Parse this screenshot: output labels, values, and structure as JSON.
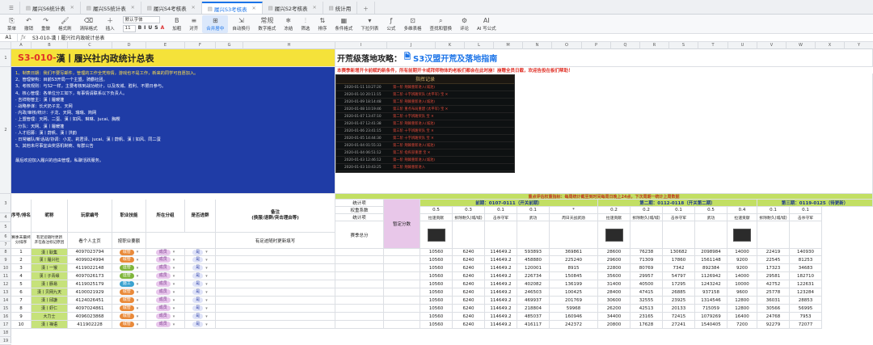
{
  "tabs": [
    {
      "label": "履兴S6统计表",
      "active": false
    },
    {
      "label": "履兴S5统计表",
      "active": false
    },
    {
      "label": "履兴S4考核表",
      "active": false
    },
    {
      "label": "履兴S3考核表",
      "active": true
    },
    {
      "label": "履兴S2考核表",
      "active": false
    },
    {
      "label": "统计用",
      "active": false
    }
  ],
  "toolbar": [
    {
      "icon": "⎘",
      "label": "菜单"
    },
    {
      "icon": "↶",
      "label": "撤销"
    },
    {
      "icon": "↷",
      "label": "重做"
    },
    {
      "icon": "🖌",
      "label": "格式刷"
    },
    {
      "icon": "⌫",
      "label": "清除格式"
    },
    {
      "icon": "＋",
      "label": "插入"
    },
    {
      "font": "默认字体",
      "size": "11"
    },
    {
      "icon": "B",
      "label": "加粗"
    },
    {
      "icon": "≡",
      "label": "对齐"
    },
    {
      "icon": "⊞",
      "label": "合并居中",
      "selected": true
    },
    {
      "icon": "⇲",
      "label": "自动换行"
    },
    {
      "icon": "常规",
      "label": "数字格式"
    },
    {
      "icon": "❄",
      "label": "冻结"
    },
    {
      "icon": "⫶",
      "label": "筛选"
    },
    {
      "icon": "⇅",
      "label": "排序"
    },
    {
      "icon": "▦",
      "label": "条件格式"
    },
    {
      "icon": "▾",
      "label": "下拉列表"
    },
    {
      "icon": "ƒ",
      "label": "公式"
    },
    {
      "icon": "⊡",
      "label": "多维表格"
    },
    {
      "icon": "⌕",
      "label": "查找和替换"
    },
    {
      "icon": "⚙",
      "label": "评论"
    },
    {
      "icon": "AI",
      "label": "AI 写公式"
    }
  ],
  "formula": {
    "ref": "A1",
    "content": "S3-010-漢丨履兴社内政统计总表"
  },
  "columns": [
    "A",
    "B",
    "C",
    "D",
    "E",
    "F",
    "G",
    "H",
    "I",
    "J",
    "K",
    "L",
    "M",
    "N",
    "O",
    "P",
    "Q",
    "R",
    "S",
    "T",
    "U",
    "V",
    "W",
    "X",
    "Y"
  ],
  "colors": {
    "title_bg": "#f5e23a",
    "body_bg": "#1f3ca6",
    "title_red": "#e03127",
    "green_hdr": "#c2df63",
    "pink": "#e8c7e9"
  },
  "title": {
    "code": "S3-010-",
    "name": "漢丨履兴社内政统计总表"
  },
  "intro": [
    "1、制表日期：我们不要写邮件，管理的工作全凭热情，游戏也不是工作，新来的同学可自愿加入。",
    "2、管理架构：目前S3开局一个主盟，骑霸社团。",
    "3、考核规则：与S2一样，主要考核到战功统计，以及攻城、胜利、不限日参与。",
    "4、核心管理：各单位分工如下，有事情请联系以下负责人。",
    "· 吉祥物管主：漢丨履暖蓬",
    "· 战略参谋：长犬奶子龙、天网",
    "· 内政/审核/统计：子龙、天网、瑞瑞、简网",
    "· 上盟管理：天网、二蛋、漢丨如风、琳琳、jucai、胸樱",
    "· 分队：天网、漢丨履暖蓬",
    "· 人才招募：漢丨蔚帆、漢丨洪韵",
    "· 日常编队/新话战/协调：小龙、莉君泽、jucai、漢丨蔚帆、漢丨如风、同二蛋",
    "5、其他未尽事宜由奖惩机制商、有群公告",
    "最后欢迎加入履兴的自由管理，私聊活跃服务。"
  ],
  "guide": {
    "title1": "开荒级落地攻略：",
    "title2": "S3汉盟开荒及落地指南",
    "sub": "本赛季新增开卡前赋的新条件，所有前期开卡或拜师物体的老板们都会在此时崩！崩赠全员日截，欢迎告投在板们帮助！"
  },
  "log": {
    "title": "指挥记录",
    "rows": [
      {
        "t": "2020-01-11 10:27:20",
        "m": "第一阶 荆棘重新进入(城池)"
      },
      {
        "t": "2020-01-10 20:11:15",
        "m": "第二阶 十字辨路奖队 (太平军) 宝 ✕"
      },
      {
        "t": "2020-01-09 18:14:48",
        "m": "第二阶 荆棘重新进入(城池)"
      },
      {
        "t": "2020-01-08 10:19:46",
        "m": "第三阶 重点布局重建 (太平军) 宝 ✕"
      },
      {
        "t": "2020-01-07 13:47:10",
        "m": "第二阶 十字辨路奖队 宝 ✕"
      },
      {
        "t": "2020-01-07 12:41:38",
        "m": "第二阶 荆棘重新进入(城池)"
      },
      {
        "t": "2020-01-06 23:41:15",
        "m": "第三阶 十字辨路奖队 宝 ✕"
      },
      {
        "t": "2020-01-05 14:44:30",
        "m": "第二阶 十字辨路奖队 宝 ✕"
      },
      {
        "t": "2020-01-04 01:55:33",
        "m": "第二阶 荆棘重新进入(城池)"
      },
      {
        "t": "2020-01-04 06:51:12",
        "m": "第二阶 指挥部重建 宝 ✕"
      },
      {
        "t": "2020-01-03 12:46:12",
        "m": "第一阶 荆棘重新进入(城池)"
      },
      {
        "t": "2020-01-03 10:43:25",
        "m": "第二阶 荆棘重新进入"
      }
    ]
  },
  "banner": "重点评估权重指标：每周统计截至到时间每周日晚上24点，下次周期一统计上周数据",
  "hdr": {
    "seq": "序号/排名",
    "member": "昵称",
    "player_id": "玩家编号",
    "role": "职业技能",
    "group": "所在分组",
    "team": "是否进群",
    "note": "备注\n(换服/退群/突击理由等)",
    "stats": "统计项",
    "weight": "权重系数",
    "total": "赛季总分",
    "note_row": "赛季末最终分排序",
    "pending": "暂定分数",
    "id_hint": "看个人主页",
    "role_hint": "按职业要额",
    "note_hint": "有足迹随时更新填写"
  },
  "phases": [
    {
      "label": "前期：0107-0111（开关前期）"
    },
    {
      "label": "第二期：0112-0118（开关第二期）"
    },
    {
      "label": "第三期：0119-0125（待更新）"
    }
  ],
  "weights": [
    "0.5",
    "0.3",
    "0.1",
    "0.1",
    "*",
    "0.2",
    "0.2",
    "0.1",
    "0.5",
    "0.4",
    "0.1",
    "0.1"
  ],
  "metrics": [
    "拉速贡献",
    "拆除耐久(城/城)",
    "击杀守军",
    "武功",
    "周日天战武勋",
    "拉速贡献",
    "拆除耐久(城/城)",
    "击杀守军",
    "武功",
    "拉速贡献",
    "拆除耐久(城/城)",
    "击杀守军"
  ],
  "rows": [
    {
      "n": "1",
      "name": "漢丨耿集",
      "id": "4097023794",
      "role": "城管",
      "rc": "#e98a3a",
      "grp": "成员",
      "team": "是",
      "v": [
        "10560",
        "6240",
        "114649.2",
        "593893",
        "369861",
        "28600",
        "76238",
        "130682",
        "2098984",
        "14000",
        "22419",
        "140930"
      ]
    },
    {
      "n": "2",
      "name": "漢丨履兴社",
      "id": "4099024994",
      "role": "城管",
      "rc": "#e98a3a",
      "grp": "成员",
      "team": "是",
      "v": [
        "10560",
        "6240",
        "114649.2",
        "458880",
        "225240",
        "29600",
        "71309",
        "17860",
        "1561148",
        "9200",
        "22545",
        "81253"
      ]
    },
    {
      "n": "3",
      "name": "漢丨一猴",
      "id": "4119022148",
      "role": "运管",
      "rc": "#7fb53b",
      "grp": "成员",
      "team": "是",
      "v": [
        "10560",
        "6240",
        "114649.2",
        "120001",
        "8915",
        "22800",
        "80769",
        "7342",
        "892384",
        "9200",
        "17323",
        "34683"
      ]
    },
    {
      "n": "4",
      "name": "漢丨子青缘",
      "id": "4097026173",
      "role": "运管",
      "rc": "#7fb53b",
      "grp": "成员",
      "team": "是",
      "v": [
        "10560",
        "6240",
        "114649.2",
        "226734",
        "150845",
        "35600",
        "29957",
        "54797",
        "1126942",
        "14000",
        "29581",
        "182710"
      ]
    },
    {
      "n": "5",
      "name": "漢丨豚易",
      "id": "4119025179",
      "role": "施工",
      "rc": "#3aa2d0",
      "grp": "成员",
      "team": "是",
      "v": [
        "10560",
        "6240",
        "114649.2",
        "402082",
        "136199",
        "31400",
        "40500",
        "17295",
        "1243242",
        "10000",
        "42752",
        "122631"
      ]
    },
    {
      "n": "6",
      "name": "漢丨贝网九天",
      "id": "4100021929",
      "role": "城管",
      "rc": "#e98a3a",
      "grp": "成员",
      "team": "是",
      "v": [
        "10560",
        "6240",
        "114649.2",
        "246503",
        "100425",
        "28400",
        "47415",
        "26885",
        "937158",
        "9600",
        "25778",
        "123284"
      ]
    },
    {
      "n": "7",
      "name": "漢丨邱謙",
      "id": "4124026451",
      "role": "城管",
      "rc": "#e98a3a",
      "grp": "成员",
      "team": "是",
      "v": [
        "10560",
        "6240",
        "114649.2",
        "469937",
        "201769",
        "30600",
        "32555",
        "23925",
        "1314546",
        "12800",
        "36031",
        "28853"
      ]
    },
    {
      "n": "8",
      "name": "漢丨虾仁",
      "id": "4097024861",
      "role": "城管",
      "rc": "#e98a3a",
      "grp": "成员",
      "team": "是",
      "v": [
        "10560",
        "6240",
        "114649.2",
        "218804",
        "59968",
        "26200",
        "42513",
        "20133",
        "715059",
        "12800",
        "30566",
        "56995"
      ]
    },
    {
      "n": "9",
      "name": "大力士",
      "id": "4096023868",
      "role": "城管",
      "rc": "#e98a3a",
      "grp": "成员",
      "team": "是",
      "v": [
        "10560",
        "6240",
        "114649.2",
        "485037",
        "160946",
        "34400",
        "23165",
        "72415",
        "1079269",
        "16400",
        "24768",
        "7953"
      ]
    },
    {
      "n": "10",
      "name": "漢丨禅语",
      "id": "411902228",
      "role": "城管",
      "rc": "#e98a3a",
      "grp": "成员",
      "team": "是",
      "v": [
        "10560",
        "6240",
        "114649.2",
        "416117",
        "242372",
        "20800",
        "17628",
        "27241",
        "1540405",
        "7200",
        "92279",
        "72077"
      ]
    }
  ]
}
